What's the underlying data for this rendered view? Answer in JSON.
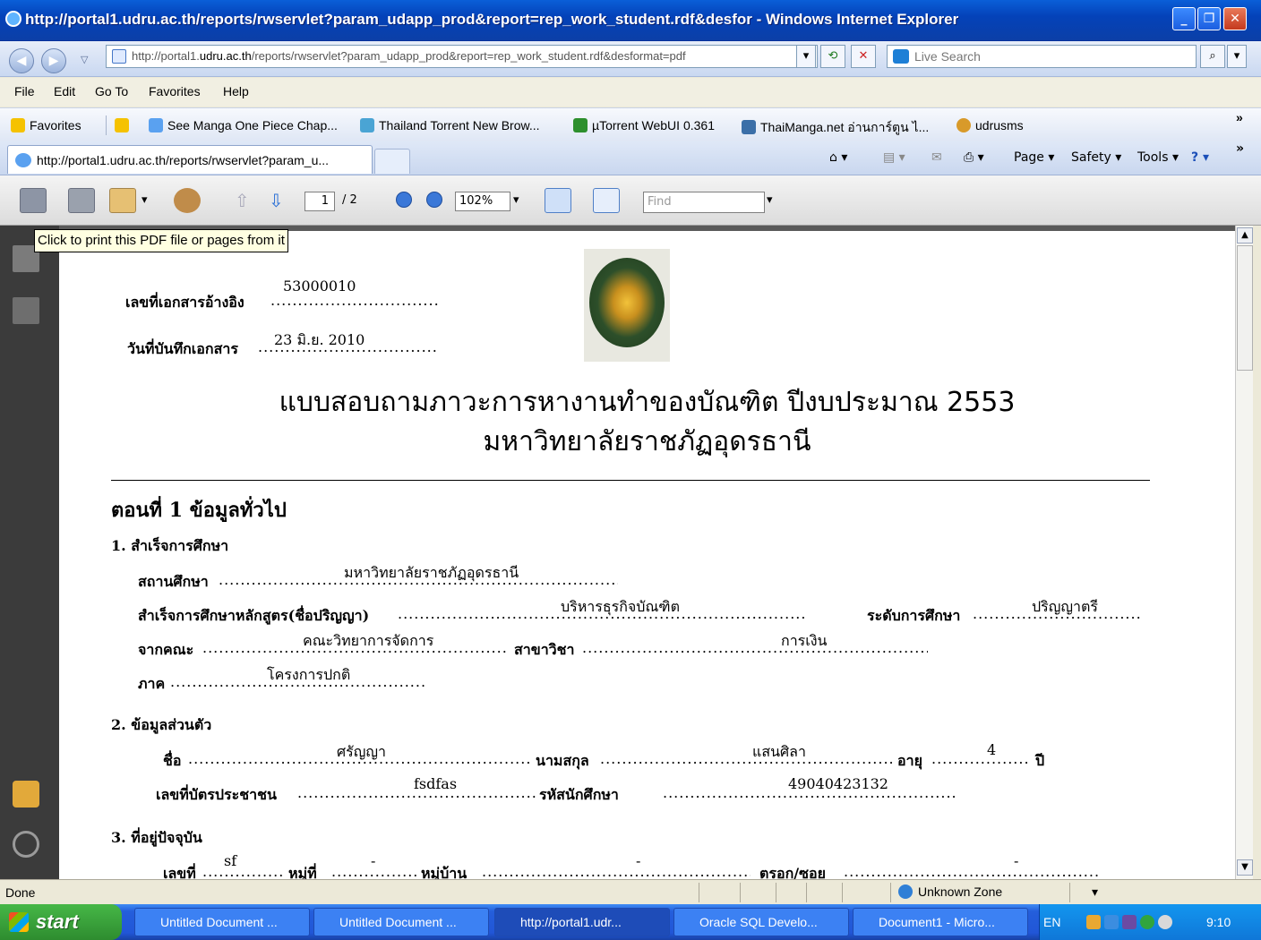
{
  "window": {
    "title": "http://portal1.udru.ac.th/reports/rwservlet?param_udapp_prod&report=rep_work_student.rdf&desfor - Windows Internet Explorer",
    "min": "_",
    "max": "❐",
    "close": "✕"
  },
  "address": {
    "prefix": "http://portal1.",
    "domain": "udru.ac.th",
    "rest": "/reports/rwservlet?param_udapp_prod&report=rep_work_student.rdf&desformat=pdf",
    "search_placeholder": "Live Search"
  },
  "menu": {
    "file": "File",
    "edit": "Edit",
    "goto": "Go To",
    "favorites": "Favorites",
    "help": "Help"
  },
  "favorites": {
    "label": "Favorites",
    "items": [
      "See Manga One Piece  Chap...",
      "Thailand Torrent  New Brow...",
      "µTorrent WebUI 0.361",
      "ThaiManga.net อ่านการ์ตูน ไ...",
      "udrusms"
    ],
    "more": "»"
  },
  "tab": {
    "title": "http://portal1.udru.ac.th/reports/rwservlet?param_u..."
  },
  "commands": {
    "page": "Page ▾",
    "safety": "Safety ▾",
    "tools": "Tools ▾",
    "more": "»"
  },
  "pdf": {
    "page_current": "1",
    "page_total": "/ 2",
    "zoom": "102%",
    "find_placeholder": "Find",
    "tooltip": "Click to print this PDF file or pages from it"
  },
  "doc": {
    "ref_label": "เลขที่เอกสารอ้างอิง",
    "ref_value": "53000010",
    "date_label": "วันที่บันทึกเอกสาร",
    "date_value": "23 มิ.ย. 2010",
    "title1": "แบบสอบถามภาวะการหางานทำของบัณฑิต ปีงบประมาณ 2553",
    "title2": "มหาวิทยาลัยราชภัฏอุดรธานี",
    "part1": "ตอนที่ 1 ข้อมูลทั่วไป",
    "s1": "1. สำเร็จการศึกษา",
    "inst_label": "สถานศึกษา",
    "inst_value": "มหาวิทยาลัยราชภัฏอุดรธานี",
    "course_label": "สำเร็จการศึกษาหลักสูตร(ชื่อปริญญา)",
    "course_value": "บริหารธุรกิจบัณฑิต",
    "level_label": "ระดับการศึกษา",
    "level_value": "ปริญญาตรี",
    "faculty_label": "จากคณะ",
    "faculty_value": "คณะวิทยาการจัดการ",
    "major_label": "สาขาวิชา",
    "major_value": "การเงิน",
    "sector_label": "ภาค",
    "sector_value": "โครงการปกติ",
    "s2": "2. ข้อมูลส่วนตัว",
    "name_label": "ชื่อ",
    "name_value": "ศรัญญา",
    "surname_label": "นามสกุล",
    "surname_value": "แสนศิลา",
    "age_label": "อายุ",
    "age_value": "4",
    "age_unit": "ปี",
    "id_label": "เลขที่บัตรประชาชน",
    "id_value": "fsdfas",
    "student_label": "รหัสนักศึกษา",
    "student_value": "49040423132",
    "s3": "3. ที่อยู่ปัจจุบัน",
    "no_label": "เลขที่",
    "no_value": "sf",
    "moo_label": "หมู่ที่",
    "moo_value": "-",
    "village_label": "หมู่บ้าน",
    "village_value": "-",
    "soi_label": "ตรอก/ซอย",
    "soi_value": "-",
    "dots": "..........................................................................................................................."
  },
  "status": {
    "text": "Done",
    "zone": "Unknown Zone",
    "zoom": "▾"
  },
  "taskbar": {
    "start": "start",
    "items": [
      "Untitled Document ...",
      "Untitled Document ...",
      "http://portal1.udr...",
      "Oracle SQL Develo...",
      "Document1 - Micro..."
    ],
    "lang": "EN",
    "time": "9:10"
  },
  "colors": {
    "title": "#0442b9",
    "viewer": "#595959",
    "sidebar": "#3b3b3b",
    "taskbar": "#245edb",
    "start": "#3c9a3c"
  }
}
